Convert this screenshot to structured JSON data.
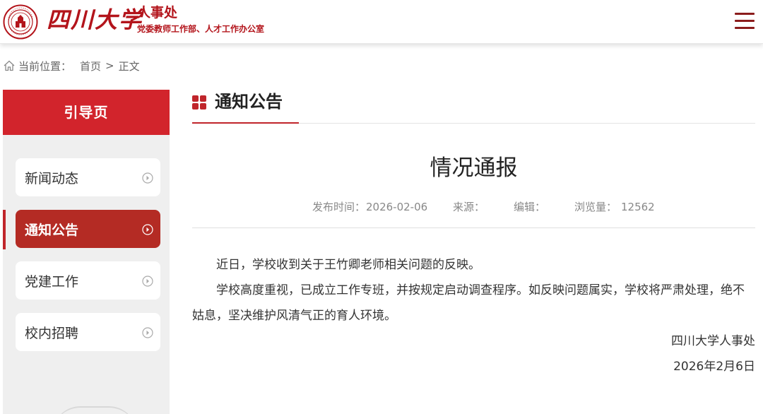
{
  "header": {
    "university_name": "四川大学",
    "dept_title": "人事处",
    "dept_subtitle": "党委教师工作部、人才工作办公室",
    "brand_color": "#b3141b",
    "seal_icon": "university-seal-icon",
    "menu_icon": "hamburger-menu-icon"
  },
  "breadcrumb": {
    "prefix": "当前位置：",
    "home": "首页",
    "separator": ">",
    "current": "正文"
  },
  "sidebar": {
    "heading": "引导页",
    "accent_color": "#d2242c",
    "items": [
      {
        "label": "新闻动态",
        "active": false
      },
      {
        "label": "通知公告",
        "active": true
      },
      {
        "label": "党建工作",
        "active": false
      },
      {
        "label": "校内招聘",
        "active": false
      }
    ]
  },
  "section": {
    "title": "通知公告"
  },
  "article": {
    "title": "情况通报",
    "meta": {
      "publish_label": "发布时间：",
      "publish_date": "2026-02-06",
      "source_label": "来源：",
      "editor_label": "编辑：",
      "views_label": "浏览量：",
      "views": "12562"
    },
    "paragraphs": [
      "近日，学校收到关于王竹卿老师相关问题的反映。",
      "学校高度重视，已成立工作专班，并按规定启动调查程序。如反映问题属实，学校将严肃处理，绝不姑息，坚决维护风清气正的育人环境。"
    ],
    "signature": "四川大学人事处",
    "sign_date": "2026年2月6日"
  }
}
